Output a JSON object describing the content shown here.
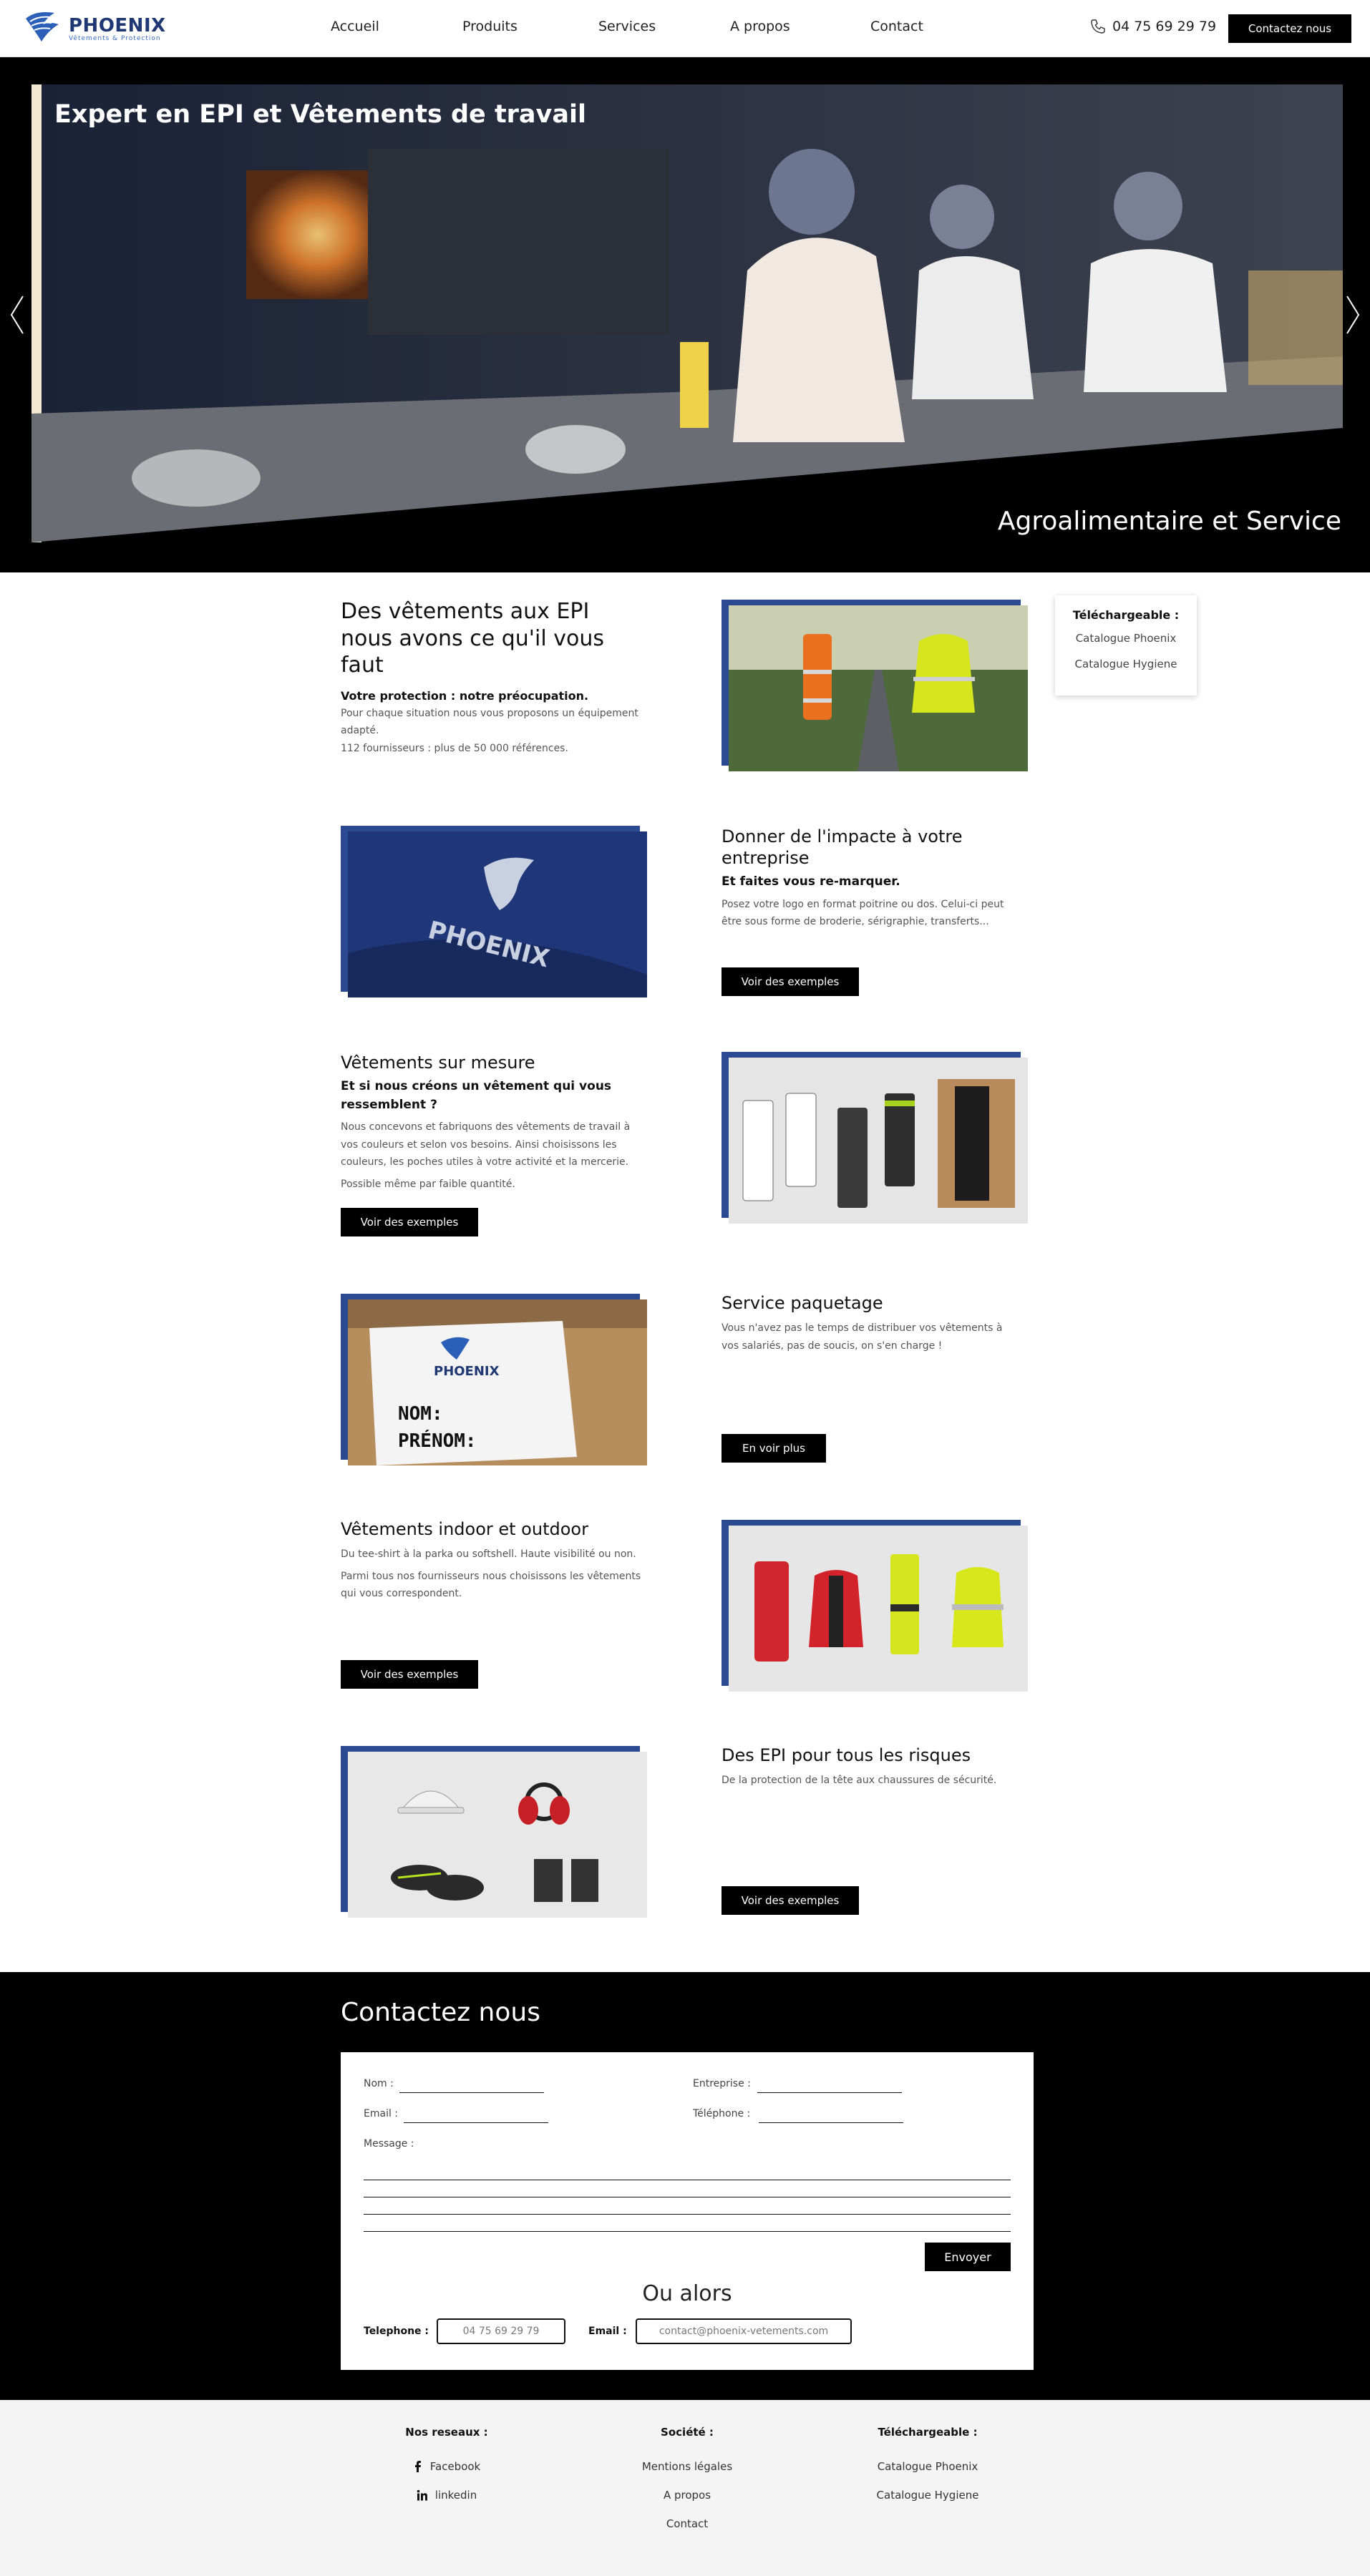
{
  "header": {
    "brand": "PHOENIX",
    "tagline": "Vêtements & Protection",
    "nav": [
      "Accueil",
      "Produits",
      "Services",
      "A propos",
      "Contact"
    ],
    "phone": "04 75 69 29 79",
    "cta": "Contactez nous"
  },
  "hero": {
    "title": "Expert en EPI et Vêtements de travail",
    "subtitle": "Agroalimentaire et Service"
  },
  "intro": {
    "title": "Des vêtements aux EPI nous avons ce qu'il vous faut",
    "subtitle": "Votre protection : notre préocupation.",
    "text1": "Pour chaque situation nous vous proposons un équipement adapté.",
    "text2": "112 fournisseurs : plus de 50 000 références."
  },
  "downloads": {
    "title": "Téléchargeable :",
    "links": [
      "Catalogue Phoenix",
      "Catalogue Hygiene"
    ]
  },
  "sections": [
    {
      "title": "Donner de l'impacte à votre entreprise",
      "subtitle": "Et faites vous re-marquer.",
      "text": "Posez votre logo en format poitrine ou dos. Celui-ci peut être sous forme de broderie, sérigraphie, transferts...",
      "button": "Voir des exemples"
    },
    {
      "title": "Vêtements sur mesure",
      "subtitle": "Et si nous créons un vêtement qui vous ressemblent ?",
      "text": "Nous concevons et fabriquons des vêtements de travail à vos couleurs et selon vos besoins. Ainsi choisissons les couleurs, les poches utiles à votre activité et la mercerie.",
      "text2": "Possible même par faible quantité.",
      "button": "Voir des exemples"
    },
    {
      "title": "Service paquetage",
      "text": "Vous n'avez pas le temps de distribuer vos vêtements à vos salariés, pas de soucis, on s'en charge !",
      "button": "En voir plus",
      "box_line1": "NOM:",
      "box_line2": "PRÉNOM:"
    },
    {
      "title": "Vêtements indoor et outdoor",
      "text": "Du tee-shirt à la parka ou softshell. Haute visibilité ou non.",
      "text2": "Parmi tous nos fournisseurs nous choisissons les vêtements qui vous correspondent.",
      "button": "Voir des exemples"
    },
    {
      "title": "Des EPI pour tous les risques",
      "text": "De la protection de la tête aux chaussures de sécurité.",
      "button": "Voir des exemples"
    }
  ],
  "contact": {
    "title": "Contactez nous",
    "fields": {
      "nom": "Nom :",
      "entreprise": "Entreprise :",
      "email": "Email :",
      "telephone": "Téléphone :",
      "message": "Message :"
    },
    "send": "Envoyer",
    "or": "Ou alors",
    "phone_label": "Telephone :",
    "phone_value": "04 75 69 29 79",
    "email_label": "Email :",
    "email_value": "contact@phoenix-vetements.com"
  },
  "footer": {
    "networks_title": "Nos reseaux :",
    "networks": [
      "Facebook",
      "linkedin"
    ],
    "company_title": "Société :",
    "company": [
      "Mentions légales",
      "A propos",
      "Contact"
    ],
    "downloads_title": "Téléchargeable :",
    "downloads": [
      "Catalogue Phoenix",
      "Catalogue Hygiene"
    ]
  },
  "colors": {
    "brand_blue": "#1f3873",
    "frame_blue": "#2b4a92",
    "black": "#000000"
  }
}
